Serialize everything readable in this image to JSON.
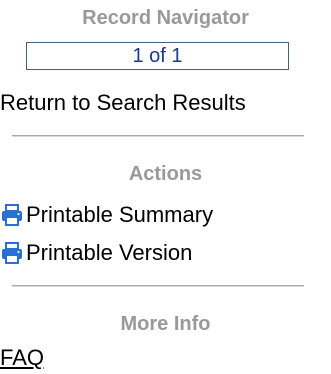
{
  "record_navigator": {
    "title": "Record Navigator",
    "position": "1 of 1",
    "return_link": "Return to Search Results"
  },
  "actions": {
    "title": "Actions",
    "items": [
      {
        "label": "Printable Summary",
        "icon": "printer-icon"
      },
      {
        "label": "Printable Version",
        "icon": "printer-icon"
      }
    ]
  },
  "more_info": {
    "title": "More Info",
    "faq_label": "FAQ"
  },
  "colors": {
    "section_title": "#999999",
    "navigator_text": "#1a3a8a",
    "icon_blue": "#2a6fd6"
  }
}
